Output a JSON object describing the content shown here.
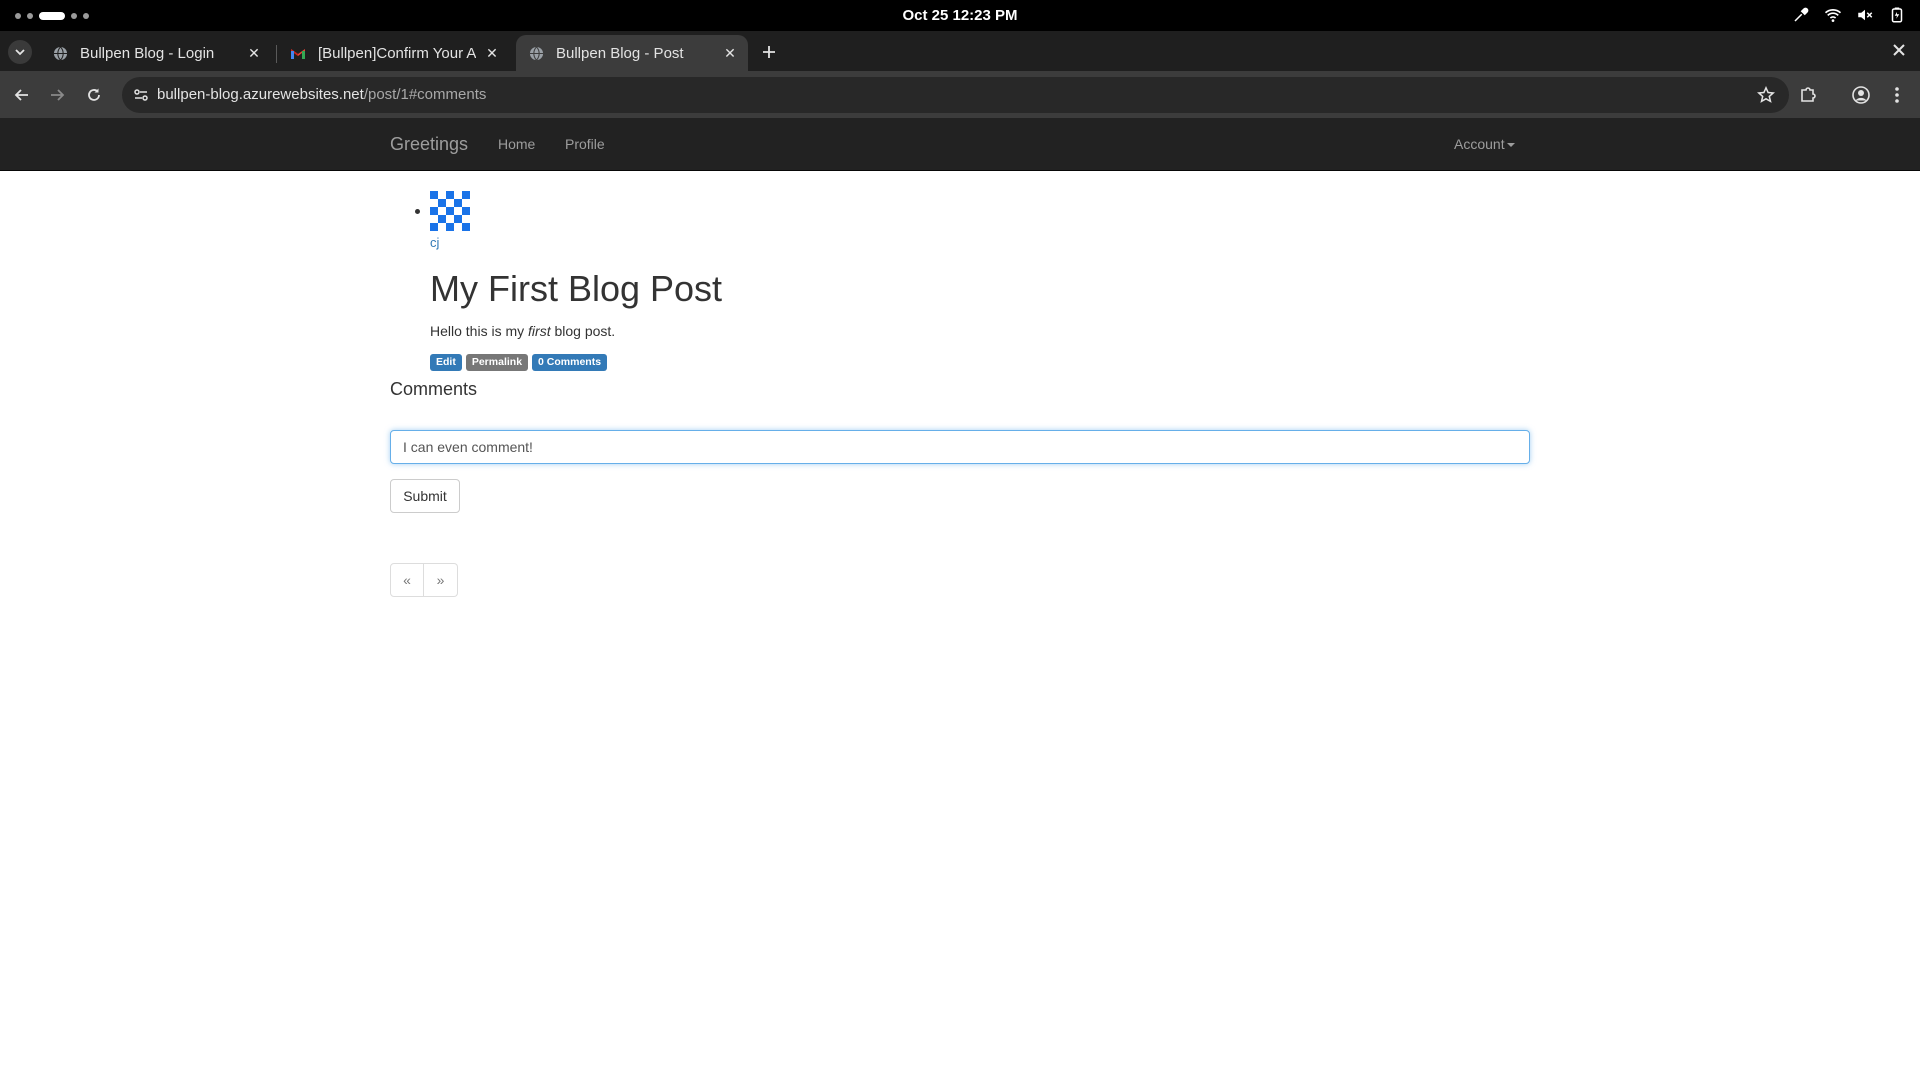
{
  "os": {
    "clock": "Oct 25  12:23 PM"
  },
  "browser": {
    "tabs": [
      {
        "title": "Bullpen Blog - Login",
        "favicon": "globe-icon",
        "active": false
      },
      {
        "title": "[Bullpen]Confirm Your Account",
        "favicon": "gmail-icon",
        "active": false
      },
      {
        "title": "Bullpen Blog - Post",
        "favicon": "globe-icon",
        "active": true
      }
    ],
    "url_host": "bullpen-blog.azurewebsites.net",
    "url_path": "/post/1#comments"
  },
  "site": {
    "brand": "Greetings",
    "nav": {
      "home": "Home",
      "profile": "Profile"
    },
    "account": "Account"
  },
  "post": {
    "author": "cj",
    "title": "My First Blog Post",
    "body_prefix": "Hello this is my ",
    "body_emphasis": "first",
    "body_suffix": " blog post.",
    "labels": {
      "edit": "Edit",
      "permalink": "Permalink",
      "comments": "0 Comments"
    }
  },
  "comments": {
    "heading": "Comments",
    "input_value": "I can even comment!",
    "submit_label": "Submit"
  },
  "pager": {
    "prev": "«",
    "next": "»"
  },
  "colors": {
    "navbar_bg": "#222222",
    "primary": "#337ab7",
    "label_default": "#777777",
    "browser_toolbar": "#3c3c3c",
    "tabstrip": "#1f1f1f"
  }
}
